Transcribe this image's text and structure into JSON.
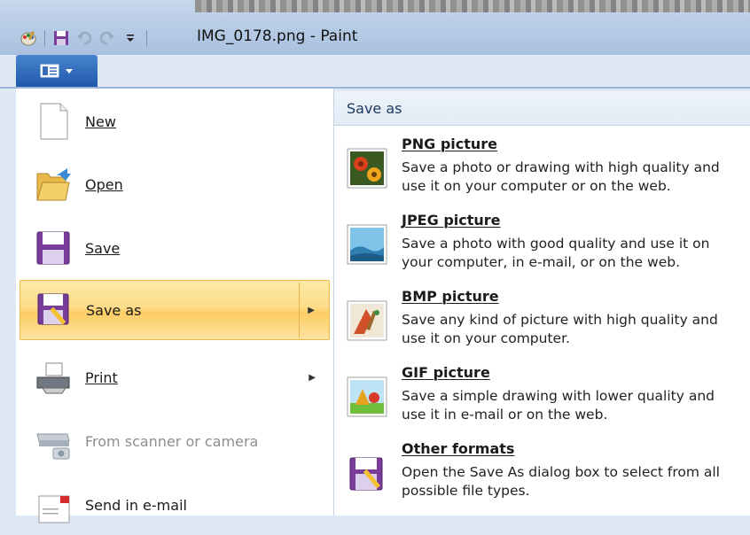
{
  "window": {
    "title": "IMG_0178.png - Paint"
  },
  "menu": {
    "items": [
      {
        "label": "New",
        "state": "normal"
      },
      {
        "label": "Open",
        "state": "normal"
      },
      {
        "label": "Save",
        "state": "normal"
      },
      {
        "label": "Save as",
        "state": "hover",
        "has_submenu": true
      },
      {
        "label": "Print",
        "state": "normal",
        "has_submenu": true
      },
      {
        "label": "From scanner or camera",
        "state": "disabled"
      },
      {
        "label": "Send in e-mail",
        "state": "normal"
      }
    ]
  },
  "submenu": {
    "header": "Save as",
    "items": [
      {
        "title": "PNG picture",
        "desc": "Save a photo or drawing with high quality and use it on your computer or on the web."
      },
      {
        "title": "JPEG picture",
        "desc": "Save a photo with good quality and use it on your computer, in e-mail, or on the web."
      },
      {
        "title": "BMP picture",
        "desc": "Save any kind of picture with high quality and use it on your computer."
      },
      {
        "title": "GIF picture",
        "desc": "Save a simple drawing with lower quality and use it in e-mail or on the web."
      },
      {
        "title": "Other formats",
        "desc": "Open the Save As dialog box to select from all possible file types."
      }
    ]
  },
  "colors": {
    "hover_bg": "#fddc8a",
    "hover_border": "#e8b94b",
    "app_button": "#2a64b4",
    "title_bar": "#b9cde6"
  },
  "icons": {
    "qat": [
      "paint-app-icon",
      "save-icon",
      "undo-icon",
      "redo-icon",
      "customize-qat-icon"
    ],
    "menu": [
      "new-document-icon",
      "open-folder-icon",
      "save-icon",
      "save-as-icon",
      "printer-icon",
      "scanner-icon",
      "email-icon"
    ],
    "submenu": [
      "png-icon",
      "jpeg-icon",
      "bmp-icon",
      "gif-icon",
      "other-formats-icon"
    ]
  }
}
